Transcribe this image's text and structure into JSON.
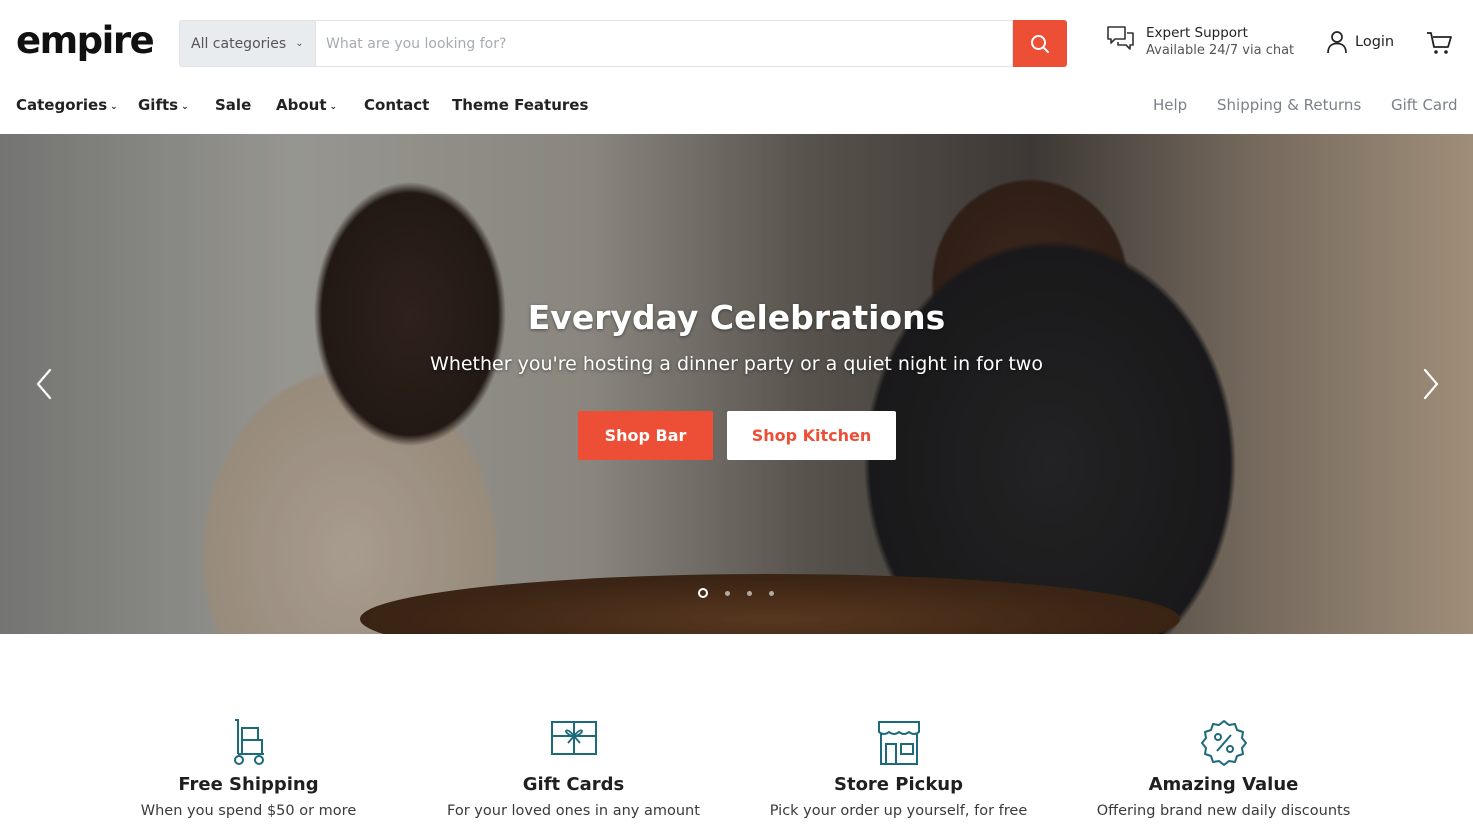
{
  "brand": {
    "logo": "empire"
  },
  "search": {
    "category": "All categories",
    "placeholder": "What are you looking for?",
    "button_icon": "search-icon"
  },
  "support": {
    "title": "Expert Support",
    "subtitle": "Available 24/7 via chat",
    "icon": "chat-icon"
  },
  "account": {
    "login_label": "Login",
    "icon": "user-icon"
  },
  "cart": {
    "icon": "cart-icon"
  },
  "nav": {
    "left": [
      {
        "label": "Categories",
        "has_dropdown": true
      },
      {
        "label": "Gifts",
        "has_dropdown": true
      },
      {
        "label": "Sale",
        "has_dropdown": false
      },
      {
        "label": "About",
        "has_dropdown": true
      },
      {
        "label": "Contact",
        "has_dropdown": false
      },
      {
        "label": "Theme Features",
        "has_dropdown": false
      }
    ],
    "right": [
      {
        "label": "Help"
      },
      {
        "label": "Shipping & Returns"
      },
      {
        "label": "Gift Card"
      }
    ]
  },
  "hero": {
    "title": "Everyday Celebrations",
    "subtitle": "Whether you're hosting a dinner party or a quiet night in for two",
    "primary_button": "Shop Bar",
    "secondary_button": "Shop Kitchen",
    "slide_count": 4,
    "active_slide": 1
  },
  "features": [
    {
      "icon": "delivery-dolly-icon",
      "title": "Free Shipping",
      "subtitle": "When you spend $50 or more"
    },
    {
      "icon": "gift-card-icon",
      "title": "Gift Cards",
      "subtitle": "For your loved ones in any amount"
    },
    {
      "icon": "storefront-icon",
      "title": "Store Pickup",
      "subtitle": "Pick your order up yourself, for free"
    },
    {
      "icon": "discount-badge-icon",
      "title": "Amazing Value",
      "subtitle": "Offering brand new daily discounts"
    }
  ],
  "colors": {
    "accent": "#ec4f35",
    "icon_teal": "#1d6a7a",
    "text": "#1f1f1f",
    "muted": "#7c8187"
  }
}
